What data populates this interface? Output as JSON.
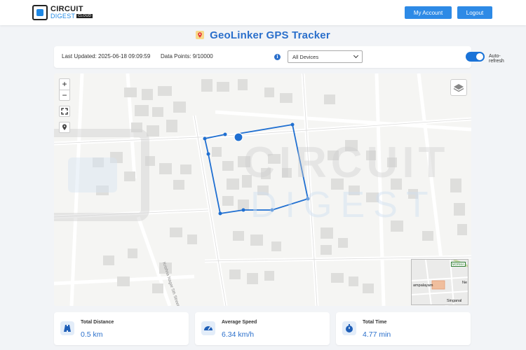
{
  "header": {
    "logo": {
      "line1": "CIRCUIT",
      "line2": "DIGEST",
      "badge": "CLOUD"
    },
    "account_label": "My Account",
    "logout_label": "Logout"
  },
  "page": {
    "title": "GeoLinker GPS Tracker"
  },
  "controls": {
    "last_updated": "Last Updated: 2025-06-18 09:09:59",
    "data_points": "Data Points: 9/10000",
    "device_select": "All Devices",
    "auto_refresh_label": "Auto-refresh",
    "auto_refresh_on": true
  },
  "map": {
    "zoom_in": "+",
    "zoom_out": "−",
    "minimap": {
      "tag": "MORMA",
      "place1": "ampalayam",
      "place2": "Singanal",
      "place3": "Ne"
    },
    "street_label": "Krishna Nagar 5th Street",
    "watermark": {
      "line1": "CIRCUIT",
      "line2": "DIGEST"
    }
  },
  "stats": [
    {
      "label": "Total Distance",
      "value": "0.5 km",
      "icon": "road-icon"
    },
    {
      "label": "Average Speed",
      "value": "6.34 km/h",
      "icon": "speedometer-icon"
    },
    {
      "label": "Total Time",
      "value": "4.77 min",
      "icon": "stopwatch-icon"
    }
  ],
  "colors": {
    "accent": "#2d8ae6",
    "title": "#2a6fcb",
    "track": "#1f6fd1"
  }
}
